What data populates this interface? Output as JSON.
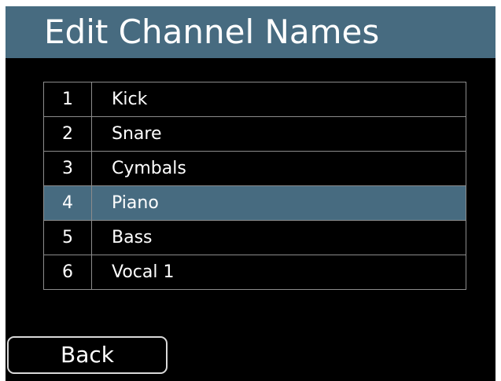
{
  "header": {
    "title": "Edit Channel Names"
  },
  "channels": [
    {
      "number": "1",
      "name": "Kick",
      "selected": false
    },
    {
      "number": "2",
      "name": "Snare",
      "selected": false
    },
    {
      "number": "3",
      "name": "Cymbals",
      "selected": false
    },
    {
      "number": "4",
      "name": "Piano",
      "selected": true
    },
    {
      "number": "5",
      "name": "Bass",
      "selected": false
    },
    {
      "number": "6",
      "name": "Vocal 1",
      "selected": false
    }
  ],
  "footer": {
    "back_label": "Back"
  },
  "colors": {
    "accent": "#476b80",
    "background": "#000000",
    "text": "#ffffff",
    "grid_line": "#8c8c8c"
  }
}
